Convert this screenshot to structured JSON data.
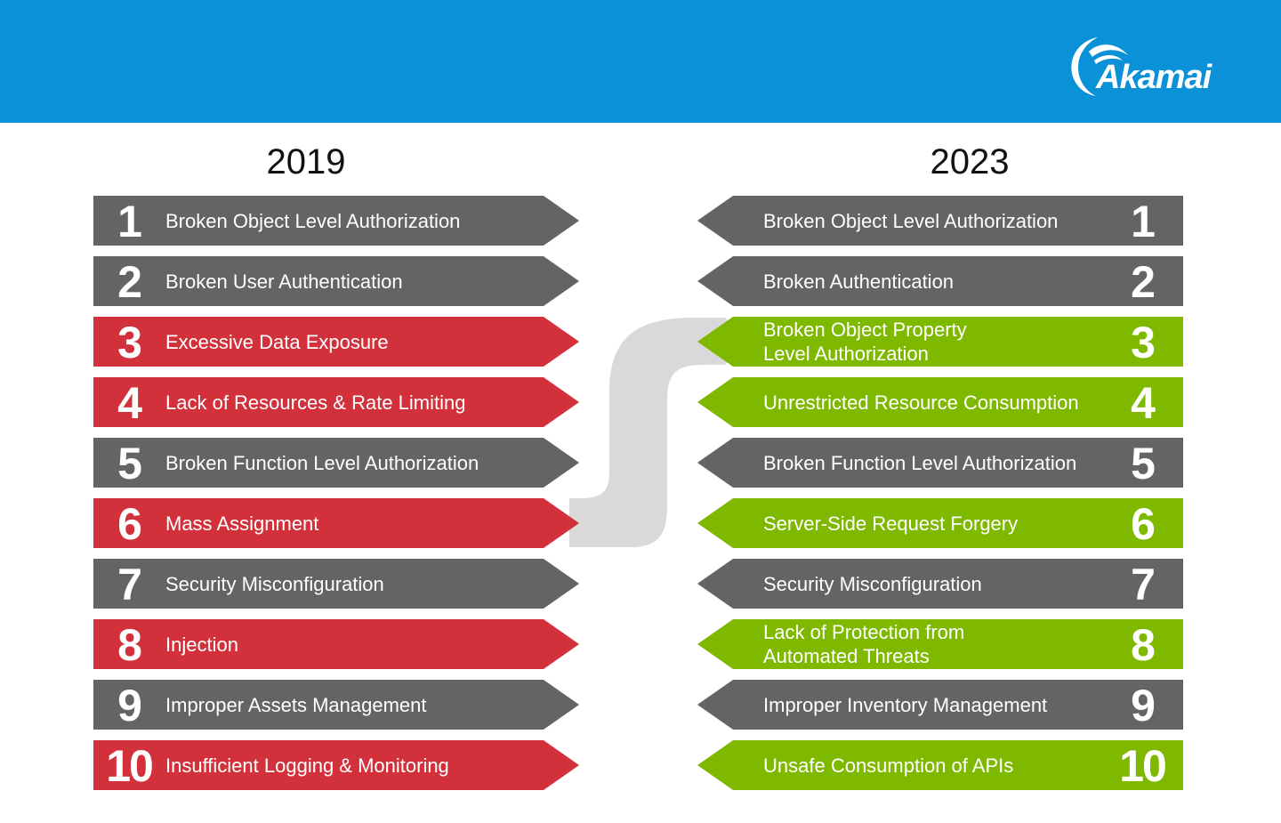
{
  "header": {
    "brand": "Akamai",
    "brand_color": "#0a91d8"
  },
  "colors": {
    "unchanged": "#646464",
    "removed_or_changed_2019": "#d2313c",
    "new_or_changed_2023": "#7eb900",
    "connector": "#d9d9d9"
  },
  "left": {
    "year": "2019",
    "items": [
      {
        "rank": "1",
        "label": "Broken Object Level Authorization",
        "status": "unchanged"
      },
      {
        "rank": "2",
        "label": "Broken User Authentication",
        "status": "unchanged"
      },
      {
        "rank": "3",
        "label": "Excessive Data Exposure",
        "status": "changed"
      },
      {
        "rank": "4",
        "label": "Lack of Resources & Rate Limiting",
        "status": "changed"
      },
      {
        "rank": "5",
        "label": "Broken Function Level Authorization",
        "status": "unchanged"
      },
      {
        "rank": "6",
        "label": "Mass Assignment",
        "status": "changed"
      },
      {
        "rank": "7",
        "label": "Security Misconfiguration",
        "status": "unchanged"
      },
      {
        "rank": "8",
        "label": "Injection",
        "status": "changed"
      },
      {
        "rank": "9",
        "label": "Improper Assets Management",
        "status": "unchanged"
      },
      {
        "rank": "10",
        "label": "Insufficient Logging & Monitoring",
        "status": "changed"
      }
    ]
  },
  "right": {
    "year": "2023",
    "items": [
      {
        "rank": "1",
        "label": "Broken Object Level Authorization",
        "status": "unchanged"
      },
      {
        "rank": "2",
        "label": "Broken Authentication",
        "status": "unchanged"
      },
      {
        "rank": "3",
        "label": "Broken Object Property Level Authorization",
        "status": "new"
      },
      {
        "rank": "4",
        "label": "Unrestricted Resource Consumption",
        "status": "new"
      },
      {
        "rank": "5",
        "label": "Broken Function Level Authorization",
        "status": "unchanged"
      },
      {
        "rank": "6",
        "label": "Server-Side Request Forgery",
        "status": "new"
      },
      {
        "rank": "7",
        "label": "Security Misconfiguration",
        "status": "unchanged"
      },
      {
        "rank": "8",
        "label": "Lack of Protection from Automated Threats",
        "status": "new"
      },
      {
        "rank": "9",
        "label": "Improper Inventory Management",
        "status": "unchanged"
      },
      {
        "rank": "10",
        "label": "Unsafe Consumption of APIs",
        "status": "new"
      }
    ]
  },
  "connector": {
    "from": "2019 #6 Mass Assignment",
    "to": "2023 #3 Broken Object Property Level Authorization"
  }
}
